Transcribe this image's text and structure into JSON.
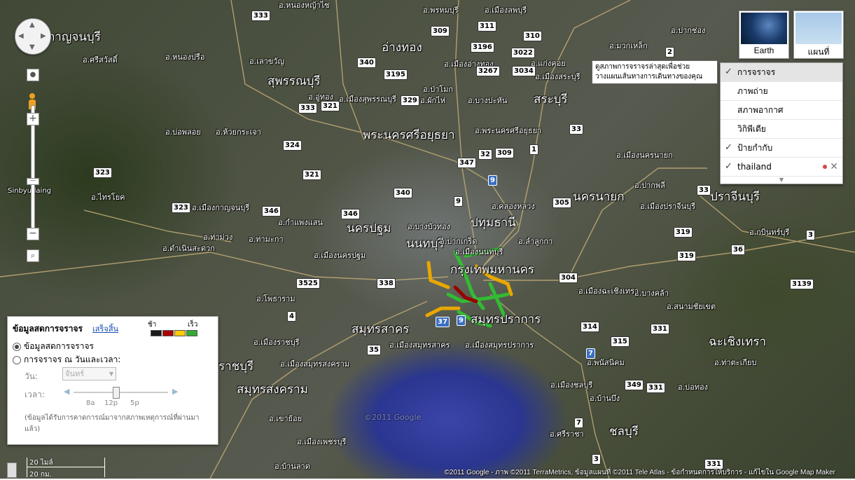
{
  "map_labels": {
    "provinces": [
      {
        "id": "p1",
        "text": "กาญจนบุรี"
      },
      {
        "id": "p2",
        "text": "อ่างทอง"
      },
      {
        "id": "p3",
        "text": "สุพรรณบุรี"
      },
      {
        "id": "p4",
        "text": "สระบุรี"
      },
      {
        "id": "p5",
        "text": "พระนครศรีอยุธยา"
      },
      {
        "id": "p6",
        "text": "นครนายก"
      },
      {
        "id": "p7",
        "text": "ปราจีนบุรี"
      },
      {
        "id": "p8",
        "text": "นครปฐม"
      },
      {
        "id": "p9",
        "text": "ปทุมธานี"
      },
      {
        "id": "p10",
        "text": "นนทบุรี"
      },
      {
        "id": "p11",
        "text": "กรุงเทพมหานคร"
      },
      {
        "id": "p12",
        "text": "สมุทรสาคร"
      },
      {
        "id": "p13",
        "text": "สมุทรปราการ"
      },
      {
        "id": "p14",
        "text": "ฉะเชิงเทรา"
      },
      {
        "id": "p15",
        "text": "ราชบุรี"
      },
      {
        "id": "p16",
        "text": "สมุทรสงคราม"
      },
      {
        "id": "p17",
        "text": "ชลบุรี"
      }
    ],
    "districts": [
      {
        "id": "d1",
        "text": "อ.ศรีสวัสดิ์"
      },
      {
        "id": "d2",
        "text": "อ.หนองปรือ"
      },
      {
        "id": "d3",
        "text": "อ.เลาขวัญ"
      },
      {
        "id": "d4",
        "text": "อ.บ่อพลอย"
      },
      {
        "id": "d5",
        "text": "อ.ห้วยกระเจา"
      },
      {
        "id": "d6",
        "text": "อ.ไทรโยค"
      },
      {
        "id": "d7",
        "text": "อ.ท่าม่วง"
      },
      {
        "id": "d8",
        "text": "อ.ท่ามะกา"
      },
      {
        "id": "d9",
        "text": "อ.กำแพงแสน"
      },
      {
        "id": "d10",
        "text": "อ.บางบัวทอง"
      },
      {
        "id": "d11",
        "text": "อ.ปากเกร็ด"
      },
      {
        "id": "d12",
        "text": "อ.ลำลูกกา"
      },
      {
        "id": "d13",
        "text": "อ.คลองหลวง"
      },
      {
        "id": "d14",
        "text": "อ.พระนครศรีอยุธยา"
      },
      {
        "id": "d15",
        "text": "อ.บางปะหัน"
      },
      {
        "id": "d16",
        "text": "อ.ผักไห่"
      },
      {
        "id": "d17",
        "text": "อ.ป่าโมก"
      },
      {
        "id": "d18",
        "text": "อ.แก่งคอย"
      },
      {
        "id": "d19",
        "text": "อ.ปากช่อง"
      },
      {
        "id": "d20",
        "text": "อ.มวกเหล็ก"
      },
      {
        "id": "d21",
        "text": "อ.ปากพลี"
      },
      {
        "id": "d22",
        "text": "อ.บางคล้า"
      },
      {
        "id": "d23",
        "text": "อ.สนามชัยเขต"
      },
      {
        "id": "d24",
        "text": "อ.ท่าตะเกียบ"
      },
      {
        "id": "d25",
        "text": "อ.พนัสนิคม"
      },
      {
        "id": "d26",
        "text": "อ.บ้านบึง"
      },
      {
        "id": "d27",
        "text": "อ.บ่อทอง"
      },
      {
        "id": "d28",
        "text": "อ.ศรีราชา"
      },
      {
        "id": "d29",
        "text": "อ.โพธาราม"
      },
      {
        "id": "d30",
        "text": "อ.เมืองราชบุรี"
      },
      {
        "id": "d31",
        "text": "อ.เขาย้อย"
      },
      {
        "id": "d32",
        "text": "อ.บ้านลาด"
      },
      {
        "id": "d33",
        "text": "อ.อู่ทอง"
      },
      {
        "id": "d34",
        "text": "อ.ดำเนินสะดวก"
      },
      {
        "id": "d35",
        "text": "อ.เมืองกาญจนบุรี"
      },
      {
        "id": "d36",
        "text": "อ.เมืองนครปฐม"
      },
      {
        "id": "d37",
        "text": "อ.เมืองสุพรรณบุรี"
      },
      {
        "id": "d38",
        "text": "อ.เมืองอ่างทอง"
      },
      {
        "id": "d39",
        "text": "อ.เมืองสระบุรี"
      },
      {
        "id": "d40",
        "text": "อ.เมืองนครนายก"
      },
      {
        "id": "d41",
        "text": "อ.เมืองปราจีนบุรี"
      },
      {
        "id": "d42",
        "text": "อ.กบินทร์บุรี"
      },
      {
        "id": "d43",
        "text": "อ.เมืองฉะเชิงเทรา"
      },
      {
        "id": "d44",
        "text": "อ.เมืองสมุทรปราการ"
      },
      {
        "id": "d45",
        "text": "อ.เมืองสมุทรสาคร"
      },
      {
        "id": "d46",
        "text": "อ.เมืองชลบุรี"
      },
      {
        "id": "d47",
        "text": "อ.เมืองสมุทรสงคราม"
      },
      {
        "id": "d48",
        "text": "อ.เมืองเพชรบุรี"
      },
      {
        "id": "d49",
        "text": "อ.เมืองนนทบุรี"
      },
      {
        "id": "d50",
        "text": "อ.หนองหญ้าไซ"
      },
      {
        "id": "d51",
        "text": "อ.พรหมบุรี"
      },
      {
        "id": "d52",
        "text": "อ.เมืองลพบุรี"
      },
      {
        "id": "d53",
        "text": "Sinbyudaing"
      }
    ],
    "routes": [
      "333",
      "309",
      "311",
      "3196",
      "310",
      "3022",
      "2",
      "340",
      "3195",
      "3267",
      "3034",
      "1",
      "329",
      "321",
      "333",
      "324",
      "323",
      "323",
      "321",
      "347",
      "32",
      "309",
      "9",
      "340",
      "346",
      "346",
      "9",
      "305",
      "33",
      "33",
      "319",
      "304",
      "319",
      "3525",
      "338",
      "4",
      "37",
      "9",
      "35",
      "314",
      "315",
      "331",
      "3139",
      "7",
      "349",
      "331",
      "7",
      "36",
      "3",
      "3",
      "331"
    ]
  },
  "controls": {
    "pan_icon": "pan-control",
    "zoom_in": "+",
    "zoom_out": "−",
    "zoom_level_fraction": 0.45
  },
  "map_type": {
    "earth_label": "Earth",
    "map_label": "แผนที่"
  },
  "tooltip": {
    "text": "ดูสภาพการจราจรล่าสุดเพื่อช่วยวางแผนเส้นทางการเดินทางของคุณ"
  },
  "layers": {
    "items": [
      {
        "label": "การจราจร",
        "checked": true,
        "selected": true
      },
      {
        "label": "ภาพถ่าย",
        "checked": false
      },
      {
        "label": "สภาพอากาศ",
        "checked": false
      },
      {
        "label": "วิกิพีเดีย",
        "checked": false
      },
      {
        "label": "ป้ายกำกับ",
        "checked": true
      },
      {
        "label": "thailand",
        "checked": true
      }
    ]
  },
  "traffic_panel": {
    "title": "ข้อมูลสดการจราจร",
    "close_link": "เสร็จสิ้น",
    "legend_slow": "ช้า",
    "legend_fast": "เร็ว",
    "legend_colors": [
      "#1a1a1a",
      "#aa0000",
      "#ffcc00",
      "#33aa33"
    ],
    "option_live": "ข้อมูลสดการจราจร",
    "option_time": "การจราจร ณ วันและเวลา:",
    "day_label": "วัน:",
    "day_value": "จันทร์",
    "time_label": "เวลา:",
    "time_ticks": [
      "8a",
      "12p",
      "5p"
    ],
    "note": "(ข้อมูลได้รับการคาดการณ์มาจากสภาพเหตุการณ์ที่ผ่านมาแล้ว)"
  },
  "scale": {
    "miles": "20 ไมล์",
    "km": "20 กม."
  },
  "footer": {
    "copyright": "©2011 Google - ภาพ ©2011 TerraMetrics, ข้อมูลแผนที่ ©2011 Tele Atlas - ข้อกำหนดการให้บริการ - แก้ไขใน Google Map Maker"
  },
  "watermark": "©2011 Google"
}
